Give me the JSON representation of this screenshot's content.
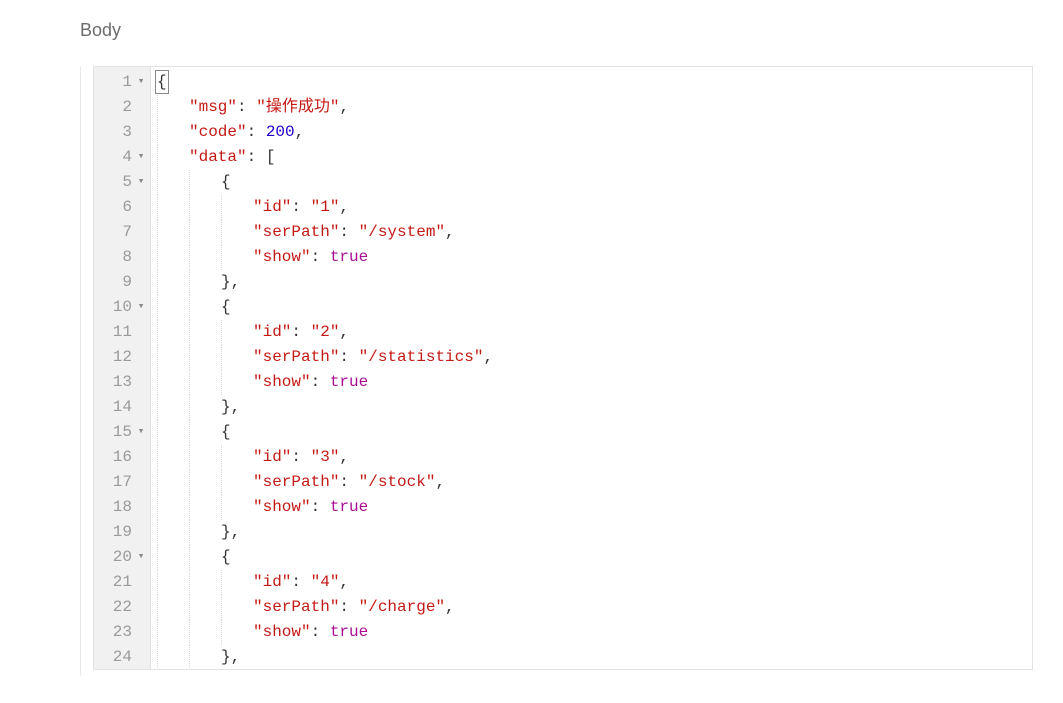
{
  "section_title": "Body",
  "lines": [
    {
      "num": "1",
      "fold": "▾",
      "indent": 0,
      "firstBrace": true,
      "tokens": [
        {
          "t": "{",
          "c": "punc"
        }
      ]
    },
    {
      "num": "2",
      "fold": "",
      "indent": 1,
      "tokens": [
        {
          "t": "\"msg\"",
          "c": "str"
        },
        {
          "t": ": ",
          "c": "punc"
        },
        {
          "t": "\"操作成功\"",
          "c": "str"
        },
        {
          "t": ",",
          "c": "punc"
        }
      ]
    },
    {
      "num": "3",
      "fold": "",
      "indent": 1,
      "tokens": [
        {
          "t": "\"code\"",
          "c": "str"
        },
        {
          "t": ": ",
          "c": "punc"
        },
        {
          "t": "200",
          "c": "num"
        },
        {
          "t": ",",
          "c": "punc"
        }
      ]
    },
    {
      "num": "4",
      "fold": "▾",
      "indent": 1,
      "tokens": [
        {
          "t": "\"data\"",
          "c": "str"
        },
        {
          "t": ": [",
          "c": "punc"
        }
      ]
    },
    {
      "num": "5",
      "fold": "▾",
      "indent": 2,
      "tokens": [
        {
          "t": "{",
          "c": "punc"
        }
      ]
    },
    {
      "num": "6",
      "fold": "",
      "indent": 3,
      "tokens": [
        {
          "t": "\"id\"",
          "c": "str"
        },
        {
          "t": ": ",
          "c": "punc"
        },
        {
          "t": "\"1\"",
          "c": "str"
        },
        {
          "t": ",",
          "c": "punc"
        }
      ]
    },
    {
      "num": "7",
      "fold": "",
      "indent": 3,
      "tokens": [
        {
          "t": "\"serPath\"",
          "c": "str"
        },
        {
          "t": ": ",
          "c": "punc"
        },
        {
          "t": "\"/system\"",
          "c": "str"
        },
        {
          "t": ",",
          "c": "punc"
        }
      ]
    },
    {
      "num": "8",
      "fold": "",
      "indent": 3,
      "tokens": [
        {
          "t": "\"show\"",
          "c": "str"
        },
        {
          "t": ": ",
          "c": "punc"
        },
        {
          "t": "true",
          "c": "bool"
        }
      ]
    },
    {
      "num": "9",
      "fold": "",
      "indent": 2,
      "tokens": [
        {
          "t": "},",
          "c": "punc"
        }
      ]
    },
    {
      "num": "10",
      "fold": "▾",
      "indent": 2,
      "tokens": [
        {
          "t": "{",
          "c": "punc"
        }
      ]
    },
    {
      "num": "11",
      "fold": "",
      "indent": 3,
      "tokens": [
        {
          "t": "\"id\"",
          "c": "str"
        },
        {
          "t": ": ",
          "c": "punc"
        },
        {
          "t": "\"2\"",
          "c": "str"
        },
        {
          "t": ",",
          "c": "punc"
        }
      ]
    },
    {
      "num": "12",
      "fold": "",
      "indent": 3,
      "tokens": [
        {
          "t": "\"serPath\"",
          "c": "str"
        },
        {
          "t": ": ",
          "c": "punc"
        },
        {
          "t": "\"/statistics\"",
          "c": "str"
        },
        {
          "t": ",",
          "c": "punc"
        }
      ]
    },
    {
      "num": "13",
      "fold": "",
      "indent": 3,
      "tokens": [
        {
          "t": "\"show\"",
          "c": "str"
        },
        {
          "t": ": ",
          "c": "punc"
        },
        {
          "t": "true",
          "c": "bool"
        }
      ]
    },
    {
      "num": "14",
      "fold": "",
      "indent": 2,
      "tokens": [
        {
          "t": "},",
          "c": "punc"
        }
      ]
    },
    {
      "num": "15",
      "fold": "▾",
      "indent": 2,
      "tokens": [
        {
          "t": "{",
          "c": "punc"
        }
      ]
    },
    {
      "num": "16",
      "fold": "",
      "indent": 3,
      "tokens": [
        {
          "t": "\"id\"",
          "c": "str"
        },
        {
          "t": ": ",
          "c": "punc"
        },
        {
          "t": "\"3\"",
          "c": "str"
        },
        {
          "t": ",",
          "c": "punc"
        }
      ]
    },
    {
      "num": "17",
      "fold": "",
      "indent": 3,
      "tokens": [
        {
          "t": "\"serPath\"",
          "c": "str"
        },
        {
          "t": ": ",
          "c": "punc"
        },
        {
          "t": "\"/stock\"",
          "c": "str"
        },
        {
          "t": ",",
          "c": "punc"
        }
      ]
    },
    {
      "num": "18",
      "fold": "",
      "indent": 3,
      "tokens": [
        {
          "t": "\"show\"",
          "c": "str"
        },
        {
          "t": ": ",
          "c": "punc"
        },
        {
          "t": "true",
          "c": "bool"
        }
      ]
    },
    {
      "num": "19",
      "fold": "",
      "indent": 2,
      "tokens": [
        {
          "t": "},",
          "c": "punc"
        }
      ]
    },
    {
      "num": "20",
      "fold": "▾",
      "indent": 2,
      "tokens": [
        {
          "t": "{",
          "c": "punc"
        }
      ]
    },
    {
      "num": "21",
      "fold": "",
      "indent": 3,
      "tokens": [
        {
          "t": "\"id\"",
          "c": "str"
        },
        {
          "t": ": ",
          "c": "punc"
        },
        {
          "t": "\"4\"",
          "c": "str"
        },
        {
          "t": ",",
          "c": "punc"
        }
      ]
    },
    {
      "num": "22",
      "fold": "",
      "indent": 3,
      "tokens": [
        {
          "t": "\"serPath\"",
          "c": "str"
        },
        {
          "t": ": ",
          "c": "punc"
        },
        {
          "t": "\"/charge\"",
          "c": "str"
        },
        {
          "t": ",",
          "c": "punc"
        }
      ]
    },
    {
      "num": "23",
      "fold": "",
      "indent": 3,
      "tokens": [
        {
          "t": "\"show\"",
          "c": "str"
        },
        {
          "t": ": ",
          "c": "punc"
        },
        {
          "t": "true",
          "c": "bool"
        }
      ]
    },
    {
      "num": "24",
      "fold": "",
      "indent": 2,
      "tokens": [
        {
          "t": "},",
          "c": "punc"
        }
      ]
    }
  ]
}
